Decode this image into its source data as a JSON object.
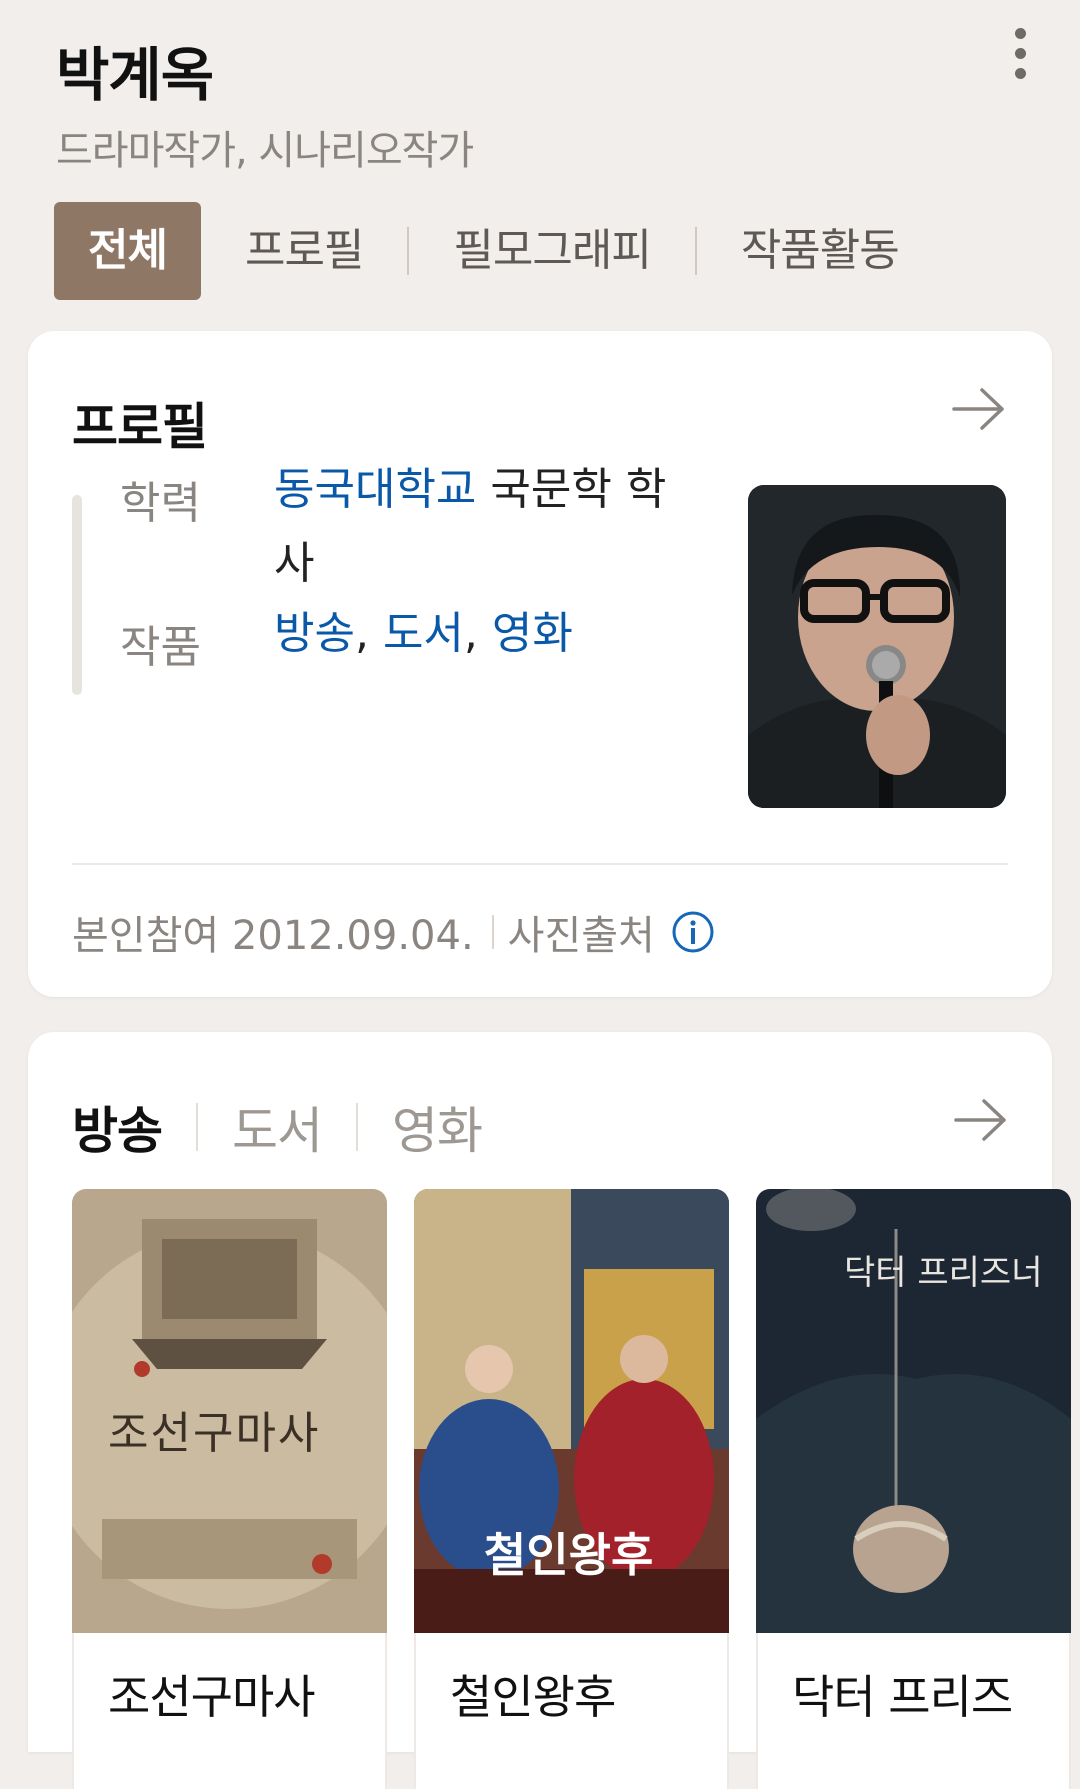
{
  "header": {
    "name": "박계옥",
    "subtitle": "드라마작가, 시나리오작가",
    "tabs": [
      {
        "label": "전체",
        "active": true
      },
      {
        "label": "프로필",
        "active": false
      },
      {
        "label": "필모그래피",
        "active": false
      },
      {
        "label": "작품활동",
        "active": false
      }
    ]
  },
  "profile": {
    "title": "프로필",
    "education_label": "학력",
    "education_school": "동국대학교",
    "education_detail_line1": " 국문학 학",
    "education_detail_line2": "사",
    "works_label": "작품",
    "works": [
      "방송",
      "도서",
      "영화"
    ],
    "works_sep": ", ",
    "footer_note": "본인참여 2012.09.04.",
    "photo_source": "사진출처"
  },
  "works_section": {
    "tabs": [
      {
        "label": "방송",
        "active": true
      },
      {
        "label": "도서",
        "active": false
      },
      {
        "label": "영화",
        "active": false
      }
    ],
    "items": [
      {
        "title": "조선구마사",
        "poster_text": "조선구마사"
      },
      {
        "title": "철인왕후",
        "poster_text": "철인왕후"
      },
      {
        "title": "닥터 프리즈",
        "poster_text": "닥터 프리즈너"
      }
    ]
  },
  "colors": {
    "active_tab_bg": "#8f7766",
    "link": "#0a58a8",
    "background": "#f1eeeb"
  },
  "icons": [
    "more-vertical-icon",
    "arrow-right-icon",
    "info-icon"
  ]
}
